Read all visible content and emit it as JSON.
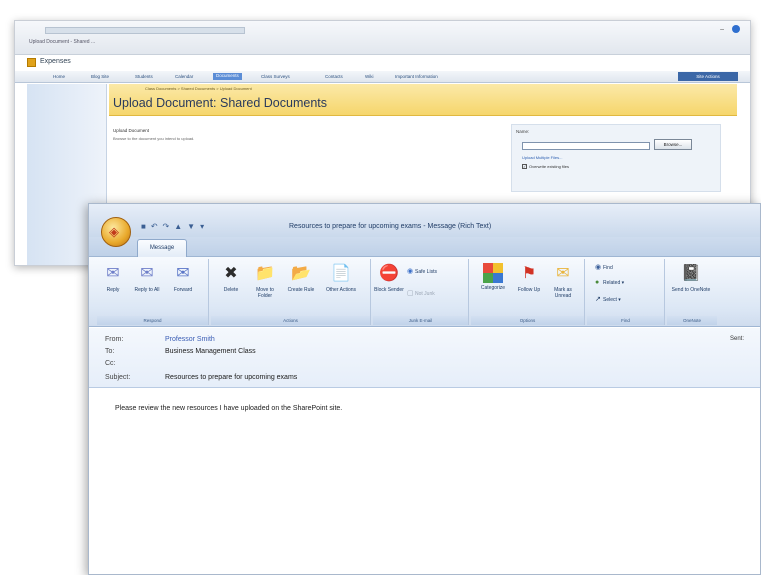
{
  "sharepoint": {
    "tab_title": "Upload Document - Shared ...",
    "site_title": "Expenses",
    "nav_items": [
      "Home",
      "Blog Site",
      "Students",
      "Calendar",
      "Documents",
      "Class Surveys",
      "Contacts",
      "Wiki",
      "Important Information"
    ],
    "active_nav_index": 4,
    "site_actions": "Site Actions",
    "breadcrumb": "Class Documents > Shared Documents > Upload Document",
    "page_title": "Upload Document: Shared Documents",
    "section_title": "Upload Document",
    "section_desc": "Browse to the document you intend to upload.",
    "field_label": "Name:",
    "browse_label": "Browse...",
    "multi_upload_link": "Upload Multiple Files...",
    "overwrite_label": "Overwrite existing files"
  },
  "outlook": {
    "window_title": "Resources to prepare for upcoming exams - Message (Rich Text)",
    "tab_message": "Message",
    "groups": [
      {
        "label": "Respond"
      },
      {
        "label": "Actions"
      },
      {
        "label": "Junk E-mail"
      },
      {
        "label": "Options"
      },
      {
        "label": "Find"
      },
      {
        "label": "OneNote"
      }
    ],
    "buttons": {
      "reply": "Reply",
      "reply_all": "Reply to All",
      "forward": "Forward",
      "delete": "Delete",
      "move_to_folder": "Move to Folder",
      "create_rule": "Create Rule",
      "other_actions": "Other Actions",
      "block_sender": "Block Sender",
      "safe_lists": "Safe Lists",
      "not_junk": "Not Junk",
      "categorize": "Categorize",
      "follow_up": "Follow Up",
      "mark_unread": "Mark as Unread",
      "find": "Find",
      "related": "Related",
      "select": "Select",
      "send_onenote": "Send to OneNote"
    },
    "headers": {
      "from_label": "From:",
      "from_value": "Professor Smith",
      "to_label": "To:",
      "to_value": "Business Management Class",
      "cc_label": "Cc:",
      "cc_value": "",
      "subject_label": "Subject:",
      "subject_value": "Resources to prepare for upcoming exams",
      "sent_label": "Sent:"
    },
    "body_text": "Please review the new resources I have uploaded on the SharePoint site."
  },
  "icons": {
    "office_orb": "office-orb-icon",
    "reply": "reply-icon",
    "reply_all": "reply-all-icon",
    "forward": "forward-icon",
    "delete": "delete-x-icon",
    "move_to_folder": "folder-icon",
    "create_rule": "rule-icon",
    "other_actions": "document-icon",
    "block_sender": "block-sender-icon",
    "categorize": "category-grid-icon",
    "follow_up": "flag-icon",
    "mark_unread": "envelope-icon",
    "send_onenote": "onenote-icon"
  }
}
